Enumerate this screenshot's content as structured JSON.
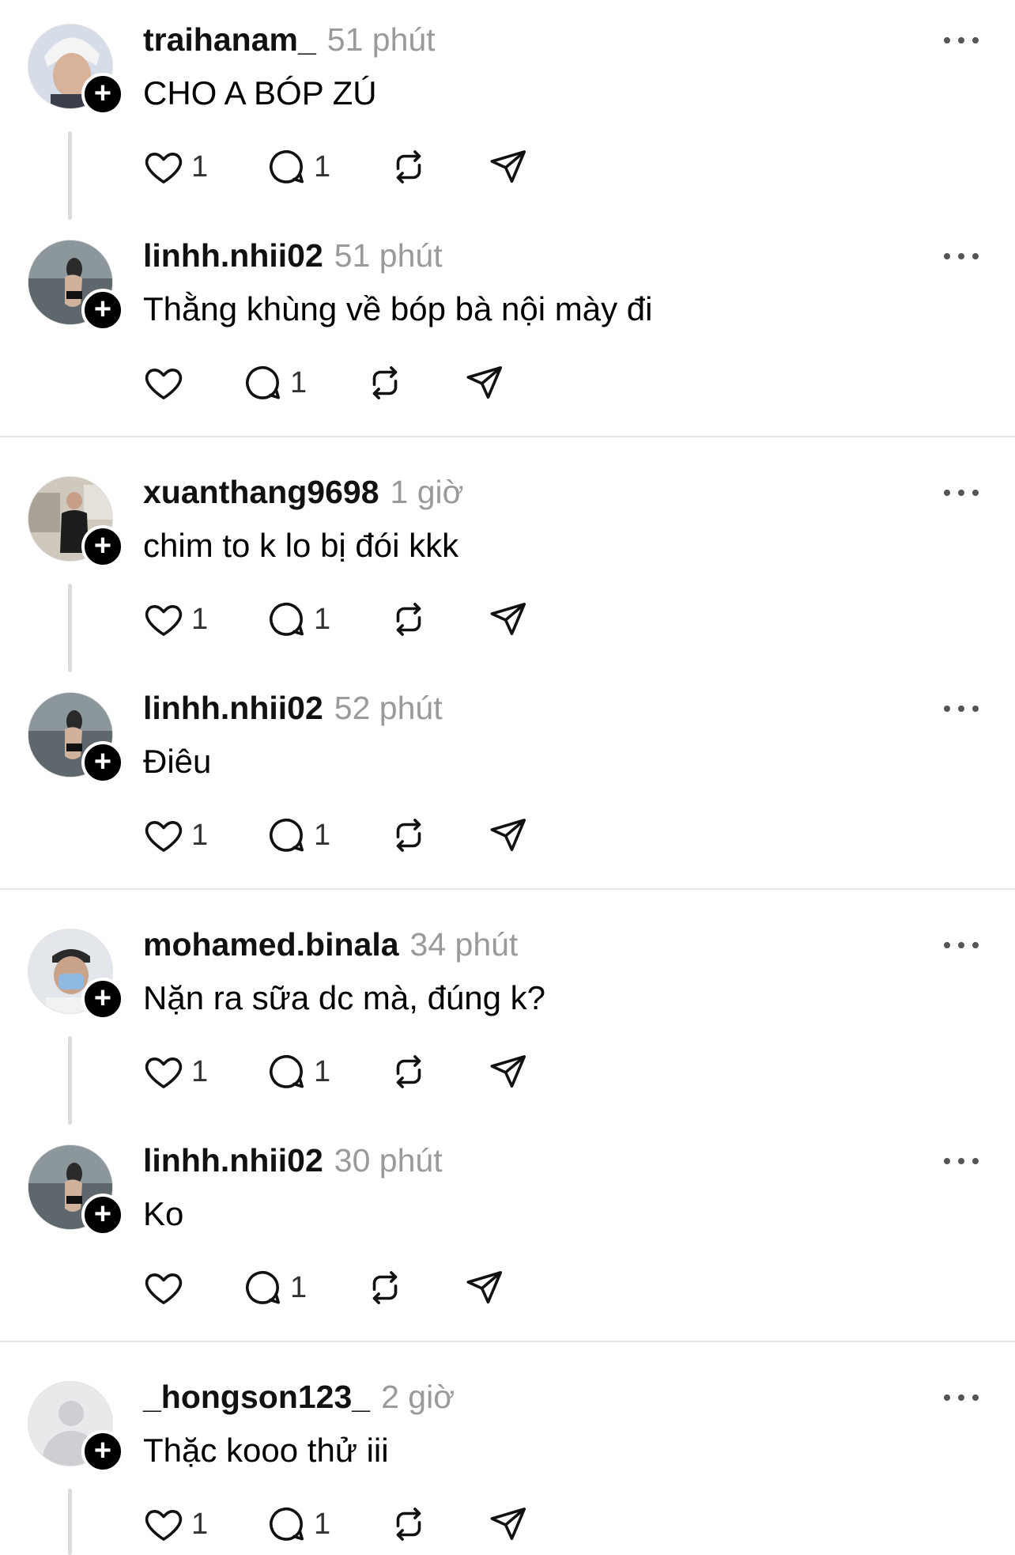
{
  "posts": [
    {
      "username": "traihanam_",
      "time": "51 phút",
      "text": "CHO A BÓP ZÚ",
      "likes": "1",
      "replies": "1",
      "avatar": "avatar-traihanam",
      "avatar_color": "#c9d3e0"
    },
    {
      "username": "linhh.nhii02",
      "time": "51 phút",
      "text": "Thằng khùng về bóp bà nội mày đi",
      "likes": "",
      "replies": "1",
      "avatar": "avatar-linhh",
      "avatar_color": "#6f7a80"
    },
    {
      "username": "xuanthang9698",
      "time": "1 giờ",
      "text": "chim to k lo bị đói kkk",
      "likes": "1",
      "replies": "1",
      "avatar": "avatar-xuanthang",
      "avatar_color": "#b8b2a6"
    },
    {
      "username": "linhh.nhii02",
      "time": "52 phút",
      "text": "Điêu",
      "likes": "1",
      "replies": "1",
      "avatar": "avatar-linhh",
      "avatar_color": "#6f7a80"
    },
    {
      "username": "mohamed.binala",
      "time": "34 phút",
      "text": "Nặn ra sữa dc mà, đúng k?",
      "likes": "1",
      "replies": "1",
      "avatar": "avatar-mohamed",
      "avatar_color": "#d9dde2"
    },
    {
      "username": "linhh.nhii02",
      "time": "30 phút",
      "text": "Ko",
      "likes": "",
      "replies": "1",
      "avatar": "avatar-linhh",
      "avatar_color": "#6f7a80"
    },
    {
      "username": "_hongson123_",
      "time": "2 giờ",
      "text": "Thặc kooo thử iii",
      "likes": "1",
      "replies": "1",
      "avatar": "default-avatar",
      "avatar_color": "#e9e9ec"
    }
  ],
  "icons": {
    "like": "heart-icon",
    "reply": "comment-icon",
    "repost": "repost-icon",
    "share": "send-icon",
    "more": "more-dots-icon",
    "follow": "plus-icon"
  },
  "follow_symbol": "+"
}
